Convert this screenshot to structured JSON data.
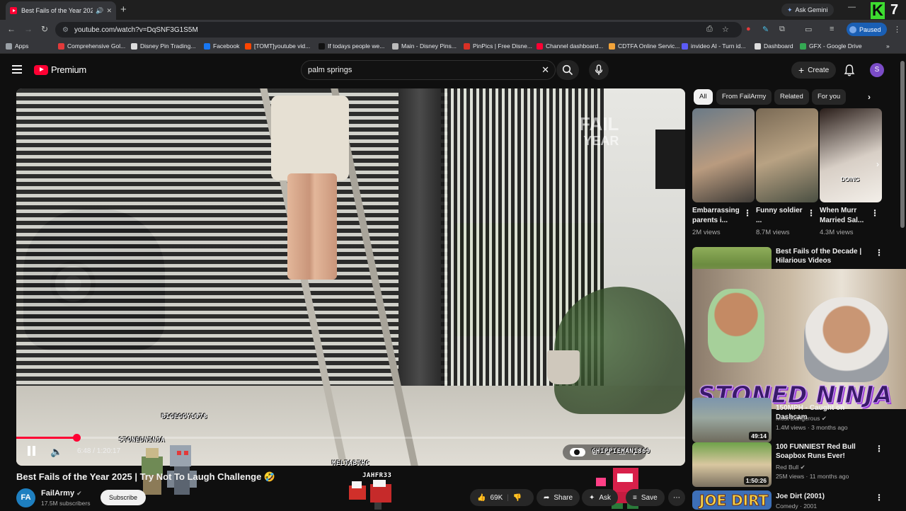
{
  "browser": {
    "tab_title": "Best Fails of the Year 2025 |",
    "gemini_label": "Ask Gemini",
    "url": "youtube.com/watch?v=DqSNF3G1S5M",
    "profile_status": "Paused",
    "channel_number": "7",
    "bookmarks": [
      {
        "label": "Apps",
        "color": "#9aa0a6"
      },
      {
        "label": "Comprehensive Gol...",
        "color": "#e23a3a"
      },
      {
        "label": "Disney Pin Trading...",
        "color": "#dddddd"
      },
      {
        "label": "Facebook",
        "color": "#1877f2"
      },
      {
        "label": "[TOMT]youtube vid...",
        "color": "#ff4500"
      },
      {
        "label": "If todays people we...",
        "color": "#111111"
      },
      {
        "label": "Main - Disney Pins...",
        "color": "#bbbbbb"
      },
      {
        "label": "PinPics | Free Disne...",
        "color": "#d93025"
      },
      {
        "label": "Channel dashboard...",
        "color": "#ff0033"
      },
      {
        "label": "CDTFA Online Servic...",
        "color": "#f2a33a"
      },
      {
        "label": "invideo AI - Turn id...",
        "color": "#5b5bf7"
      },
      {
        "label": "Dashboard",
        "color": "#dddddd"
      },
      {
        "label": "GFX - Google Drive",
        "color": "#34a853"
      }
    ]
  },
  "youtube": {
    "brand": "Premium",
    "search_query": "palm springs",
    "create_label": "Create",
    "avatar_letter": "S"
  },
  "player": {
    "progress": 0.09,
    "time": "6:48 / 1:20:17",
    "watermark_line1": "FAIL",
    "watermark_line2": "YEAR",
    "overlay_handle": "CHIPPIEMAN1869",
    "overlay_names": [
      "BIGEGGY1978",
      "STONEDNINJA",
      "MELTABTHC",
      "JAHFR33"
    ]
  },
  "video": {
    "title": "Best Fails of the Year 2025 | Try Not To Laugh Challenge 🤣",
    "channel": "FailArmy",
    "subscribers": "17.5M subscribers",
    "subscribe_label": "Subscribe",
    "likes": "69K",
    "share_label": "Share",
    "ask_label": "Ask",
    "save_label": "Save"
  },
  "sidebar": {
    "chips": [
      "All",
      "From FailArmy",
      "Related",
      "For you"
    ],
    "shorts": [
      {
        "title": "Embarrassing parents i...",
        "views": "2M views"
      },
      {
        "title": "Funny soldier ...",
        "views": "8.7M views"
      },
      {
        "title": "When Murr Married Sal...",
        "views": "4.3M views"
      }
    ],
    "recommended": [
      {
        "title": "Best Fails of the Decade | Hilarious Videos",
        "channel": "",
        "meta": ""
      },
      {
        "title": "150MPH - Caught on Dashcam",
        "channel": "Most Dangerous",
        "meta": "1.4M views · 3 months ago",
        "duration": "49:14"
      },
      {
        "title": "100 FUNNIEST Red Bull Soapbox Runs Ever!",
        "channel": "Red Bull",
        "meta": "25M views · 11 months ago",
        "duration": "1:50:26"
      },
      {
        "title": "Joe Dirt (2001)",
        "channel": "",
        "meta": "Comedy · 2001",
        "thumb_text": "JOE DIRT"
      }
    ],
    "overlay_banner": "STONED NINJA"
  }
}
